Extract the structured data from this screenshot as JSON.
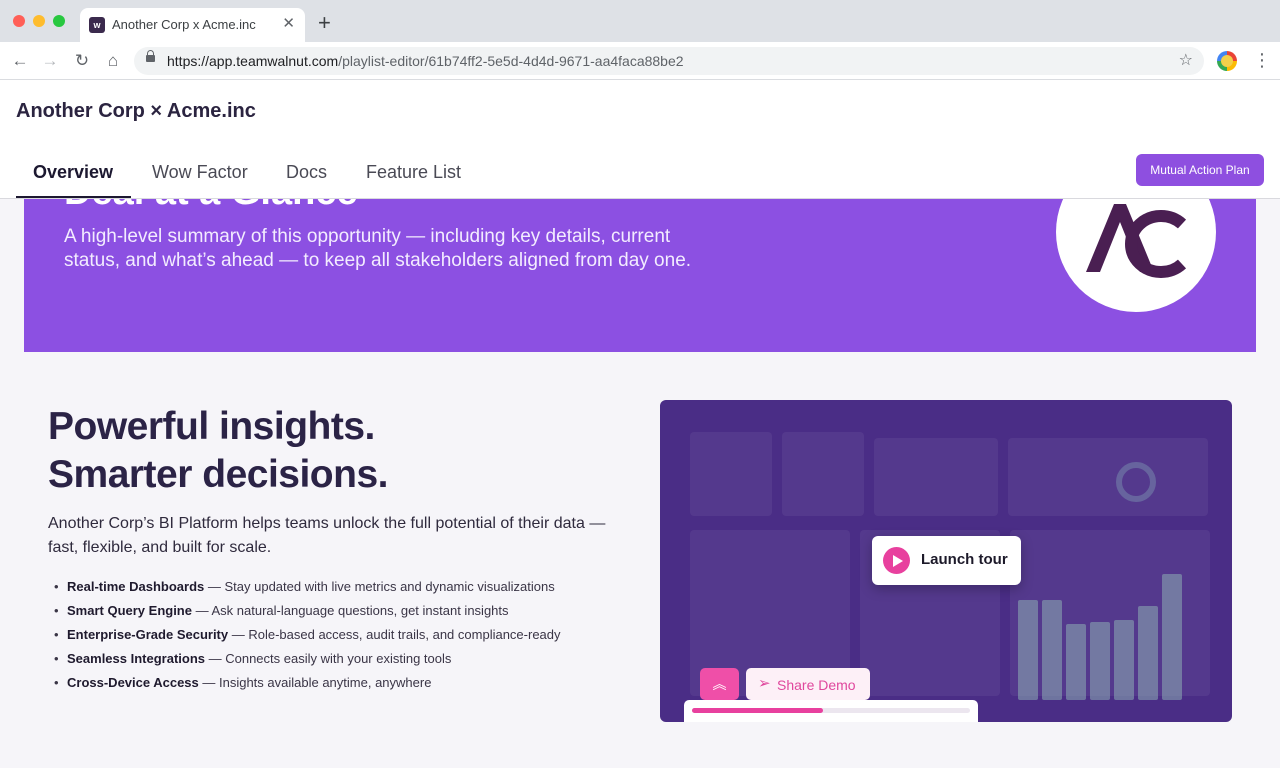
{
  "browser": {
    "tab_title": "Another Corp x Acme.inc",
    "favicon_letter": "w",
    "url_host": "https://app.teamwalnut.com",
    "url_path": "/playlist-editor/61b74ff2-5e5d-4d4d-9671-aa4faca88be2"
  },
  "header": {
    "title": "Another Corp × Acme.inc",
    "tabs": [
      {
        "label": "Overview",
        "active": true
      },
      {
        "label": "Wow Factor",
        "active": false
      },
      {
        "label": "Docs",
        "active": false
      },
      {
        "label": "Feature List",
        "active": false
      }
    ],
    "action_button": "Mutual Action Plan"
  },
  "hero": {
    "heading": "Deal at a Glance",
    "description": "A high-level summary of this opportunity — including key details, current status, and what’s ahead — to keep all stakeholders aligned from day one.",
    "logo_text": "AC"
  },
  "main": {
    "headline_line1": "Powerful insights.",
    "headline_line2": "Smarter decisions.",
    "body": "Another Corp’s BI Platform helps teams unlock the full potential of their data — fast, flexible, and built for scale.",
    "features": [
      {
        "name": "Real-time Dashboards",
        "desc": " — Stay updated with live metrics and dynamic visualizations"
      },
      {
        "name": "Smart Query Engine",
        "desc": " — Ask natural-language questions, get instant insights"
      },
      {
        "name": "Enterprise-Grade Security",
        "desc": " — Role-based access, audit trails, and compliance-ready"
      },
      {
        "name": "Seamless Integrations",
        "desc": " — Connects easily with your existing tools"
      },
      {
        "name": "Cross-Device Access",
        "desc": " — Insights available anytime, anywhere"
      }
    ]
  },
  "demo": {
    "launch_label": "Launch tour",
    "share_label": "Share Demo",
    "progress": 0.47
  },
  "colors": {
    "accent_purple": "#8c50e2",
    "accent_pink": "#e8409e",
    "demo_bg": "#4a2d86"
  },
  "icons": {
    "new_tab": "plus-icon",
    "back": "arrow-left-icon",
    "forward": "arrow-right-icon",
    "reload": "reload-icon",
    "home": "home-icon",
    "lock": "lock-icon",
    "bookmark": "star-icon",
    "menu": "kebab-menu-icon",
    "play": "play-icon",
    "collapse": "chevrons-up-icon",
    "share": "paper-plane-icon"
  }
}
